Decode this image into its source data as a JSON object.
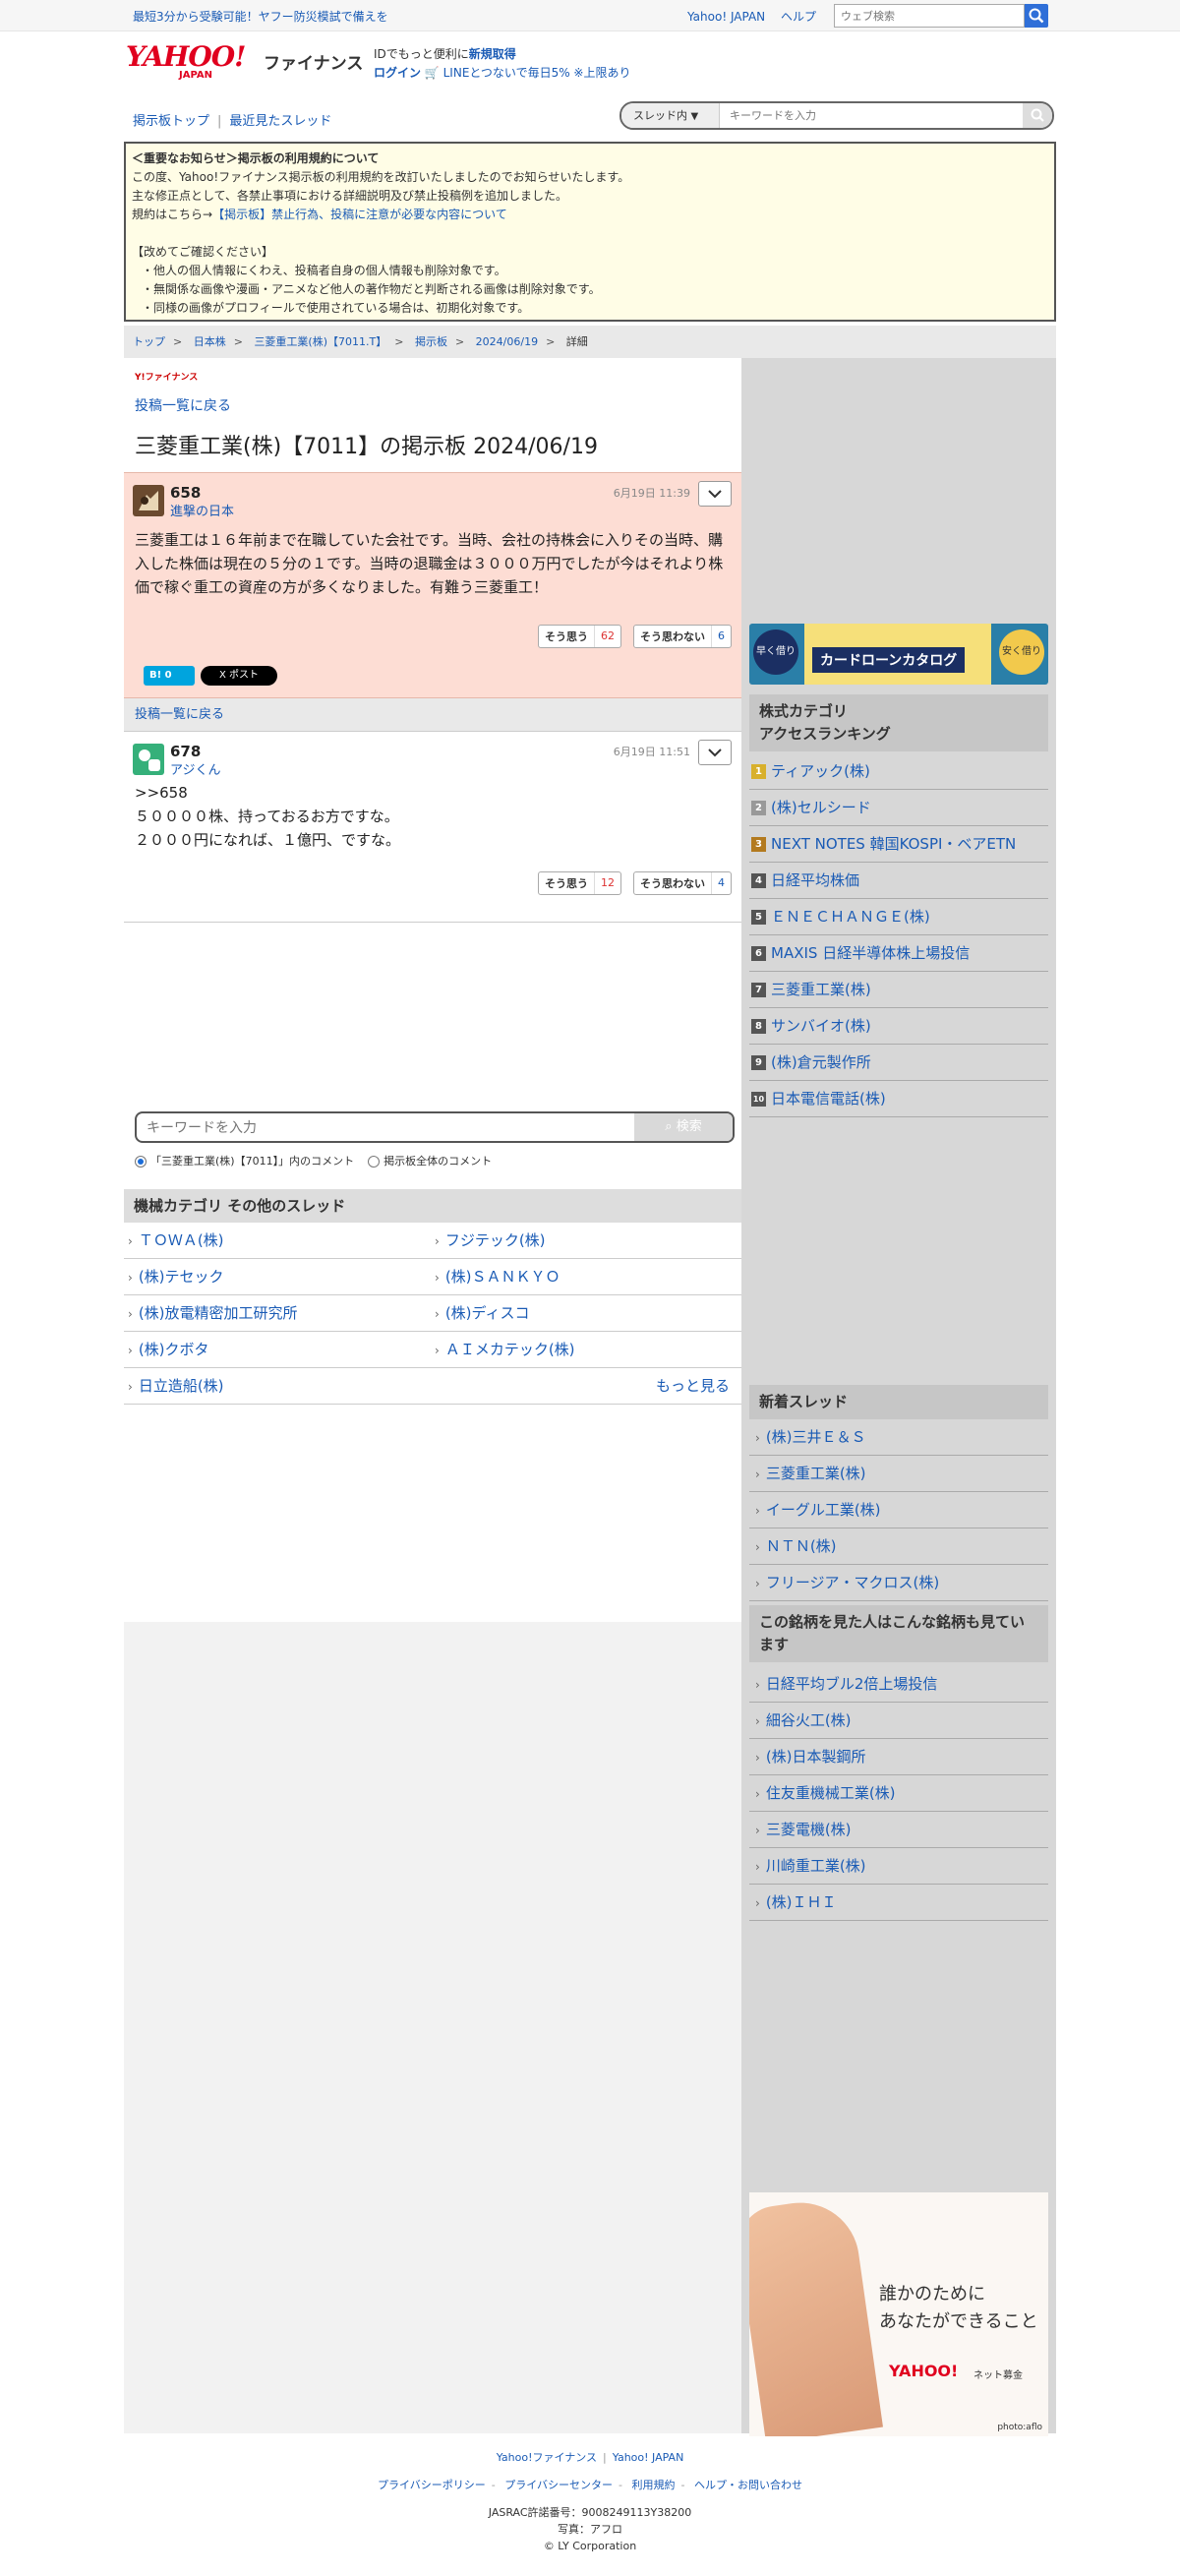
{
  "topbar": {
    "promo": "最短3分から受験可能！ヤフー防災模試で備えを",
    "links": [
      "Yahoo! JAPAN",
      "ヘルプ"
    ],
    "search_placeholder": "ウェブ検索"
  },
  "header": {
    "logo_text": "YAHOO!",
    "logo_sub": "JAPAN",
    "brand": "ファイナンス",
    "msg_line1_pre": "IDでもっと便利に",
    "msg_line1_link": "新規取得",
    "msg_line2_link": "ログイン",
    "msg_line2_rest": "LINEとつないで毎日5% ※上限あり"
  },
  "subnav": {
    "board_top": "掲示板トップ",
    "recent": "最近見たスレッド"
  },
  "thread_search": {
    "scope": "スレッド内",
    "placeholder": "キーワードを入力"
  },
  "notice": {
    "title": "＜重要なお知らせ＞掲示板の利用規約について",
    "lines": [
      "この度、Yahoo!ファイナンス掲示板の利用規約を改訂いたしましたのでお知らせいたします。",
      "主な修正点として、各禁止事項における詳細説明及び禁止投稿例を追加しました。",
      "",
      "",
      "【改めてご確認ください】",
      "・他人の個人情報にくわえ、投稿者自身の個人情報も削除対象です。",
      "・無関係な画像や漫画・アニメなど他人の著作物だと判断される画像は削除対象です。",
      "・同様の画像がプロフィールで使用されている場合は、初期化対象です。"
    ],
    "rule_prefix": "規約はこちら→",
    "rule_link": "【掲示板】禁止行為、投稿に注意が必要な内容について"
  },
  "breadcrumb": [
    "トップ",
    "日本株",
    "三菱重工業(株)【7011.T】",
    "掲示板",
    "2024/06/19",
    "詳細"
  ],
  "main": {
    "small_logo": "Y!ファイナンス",
    "back_link": "投稿一覧に戻る",
    "page_title": "三菱重工業(株)【7011】の掲示板 2024/06/19",
    "posts": [
      {
        "num": "658",
        "user": "進撃の日本",
        "date": "6月19日 11:39",
        "body": "三菱重工は１６年前まで在職していた会社です。当時、会社の持株会に入りその当時、購入した株価は現在の５分の１です。当時の退職金は３０００万円でしたが今はそれより株価で稼ぐ重工の資産の方が多くなりました。有難う三菱重工！",
        "agree_label": "そう思う",
        "agree": "62",
        "disagree_label": "そう思わない",
        "disagree": "6"
      },
      {
        "num": "678",
        "user": "アジくん",
        "date": "6月19日 11:51",
        "body_lines": [
          ">>658",
          "５００００株、持っておるお方ですな。",
          "２０００円になれば、１億円、ですな。"
        ],
        "agree_label": "そう思う",
        "agree": "12",
        "disagree_label": "そう思わない",
        "disagree": "4"
      }
    ],
    "share_hatena": "B! 0",
    "share_x": "X ポスト",
    "back_bar": "投稿一覧に戻る",
    "kw_placeholder": "キーワードを入力",
    "kw_button": "検索",
    "radio_thread": "「三菱重工業(株)【7011】」内のコメント",
    "radio_all": "掲示板全体のコメント",
    "cat_header": "機械カテゴリ その他のスレッド",
    "cat_items": [
      [
        "ＴＯＷＡ(株)",
        "フジテック(株)"
      ],
      [
        "(株)テセック",
        "(株)ＳＡＮＫＹＯ"
      ],
      [
        "(株)放電精密加工研究所",
        "(株)ディスコ"
      ],
      [
        "(株)クボタ",
        "ＡＩメカテック(株)"
      ],
      [
        "日立造船(株)",
        ""
      ]
    ],
    "more": "もっと見る"
  },
  "side": {
    "ad1_label": "カードローンカタログ",
    "ad1_left": "早く借りる",
    "ad1_right": "安く借りる",
    "ranking_title_1": "株式カテゴリ",
    "ranking_title_2": "アクセスランキング",
    "ranking": [
      "ティアック(株)",
      "(株)セルシード",
      "NEXT NOTES 韓国KOSPI・ベアETN",
      "日経平均株価",
      "ＥＮＥＣＨＡＮＧＥ(株)",
      "MAXIS 日経半導体株上場投信",
      "三菱重工業(株)",
      "サンバイオ(株)",
      "(株)倉元製作所",
      "日本電信電話(株)"
    ],
    "new_threads_title": "新着スレッド",
    "new_threads": [
      "(株)三井Ｅ＆Ｓ",
      "三菱重工業(株)",
      "イーグル工業(株)",
      "ＮＴＮ(株)",
      "フリージア・マクロス(株)"
    ],
    "also_viewed_title": "この銘柄を見た人はこんな銘柄も見ています",
    "also_viewed": [
      "日経平均ブル2倍上場投信",
      "細谷火工(株)",
      "(株)日本製鋼所",
      "住友重機械工業(株)",
      "三菱電機(株)",
      "川崎重工業(株)",
      "(株)ＩＨＩ"
    ],
    "ad2_line1": "誰かのために",
    "ad2_line2": "あなたができること",
    "ad2_brand": "YAHOO!",
    "ad2_sub": "ネット募金",
    "ad2_credit": "photo:aflo"
  },
  "footer": {
    "row1": [
      "Yahoo!ファイナンス",
      "Yahoo! JAPAN"
    ],
    "row2": [
      "プライバシーポリシー",
      "プライバシーセンター",
      "利用規約",
      "ヘルプ・お問い合わせ"
    ],
    "jasrac": "JASRAC許諾番号：9008249113Y38200",
    "photo": "写真：アフロ",
    "copyright": "© LY Corporation"
  },
  "colors": {
    "link": "#1a5bb5",
    "post_highlight": "#fdddd4",
    "notice_bg": "#fffde6",
    "search_blue": "#2f6fd8"
  }
}
